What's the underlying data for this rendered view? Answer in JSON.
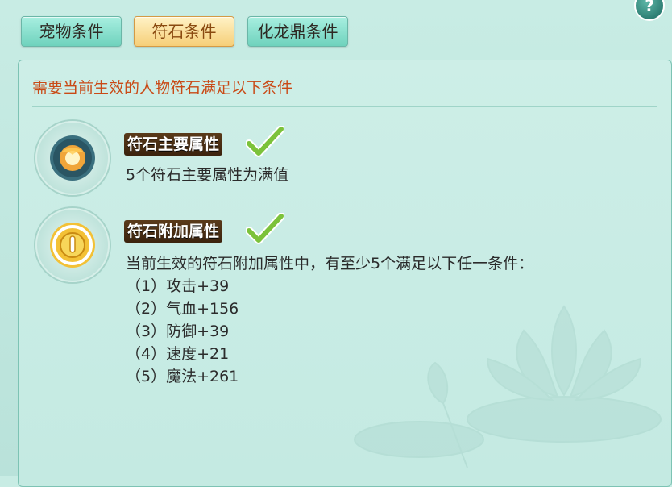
{
  "tabs": [
    {
      "label": "宠物条件",
      "active": false
    },
    {
      "label": "符石条件",
      "active": true
    },
    {
      "label": "化龙鼎条件",
      "active": false
    }
  ],
  "help": {
    "label": "?"
  },
  "headline": "需要当前生效的人物符石满足以下条件",
  "condition1": {
    "title": "符石主要属性",
    "status_icon": "checkmark-icon",
    "description": "5个符石主要属性为满值"
  },
  "condition2": {
    "title": "符石附加属性",
    "status_icon": "checkmark-icon",
    "description": "当前生效的符石附加属性中，有至少5个满足以下任一条件：",
    "items": [
      "（1）攻击+39",
      "（2）气血+156",
      "（3）防御+39",
      "（4）速度+21",
      "（5）魔法+261"
    ]
  },
  "colors": {
    "headline": "#c94a16",
    "checkmark": "#7cc23a",
    "panel_bg": "#c4eae2"
  }
}
